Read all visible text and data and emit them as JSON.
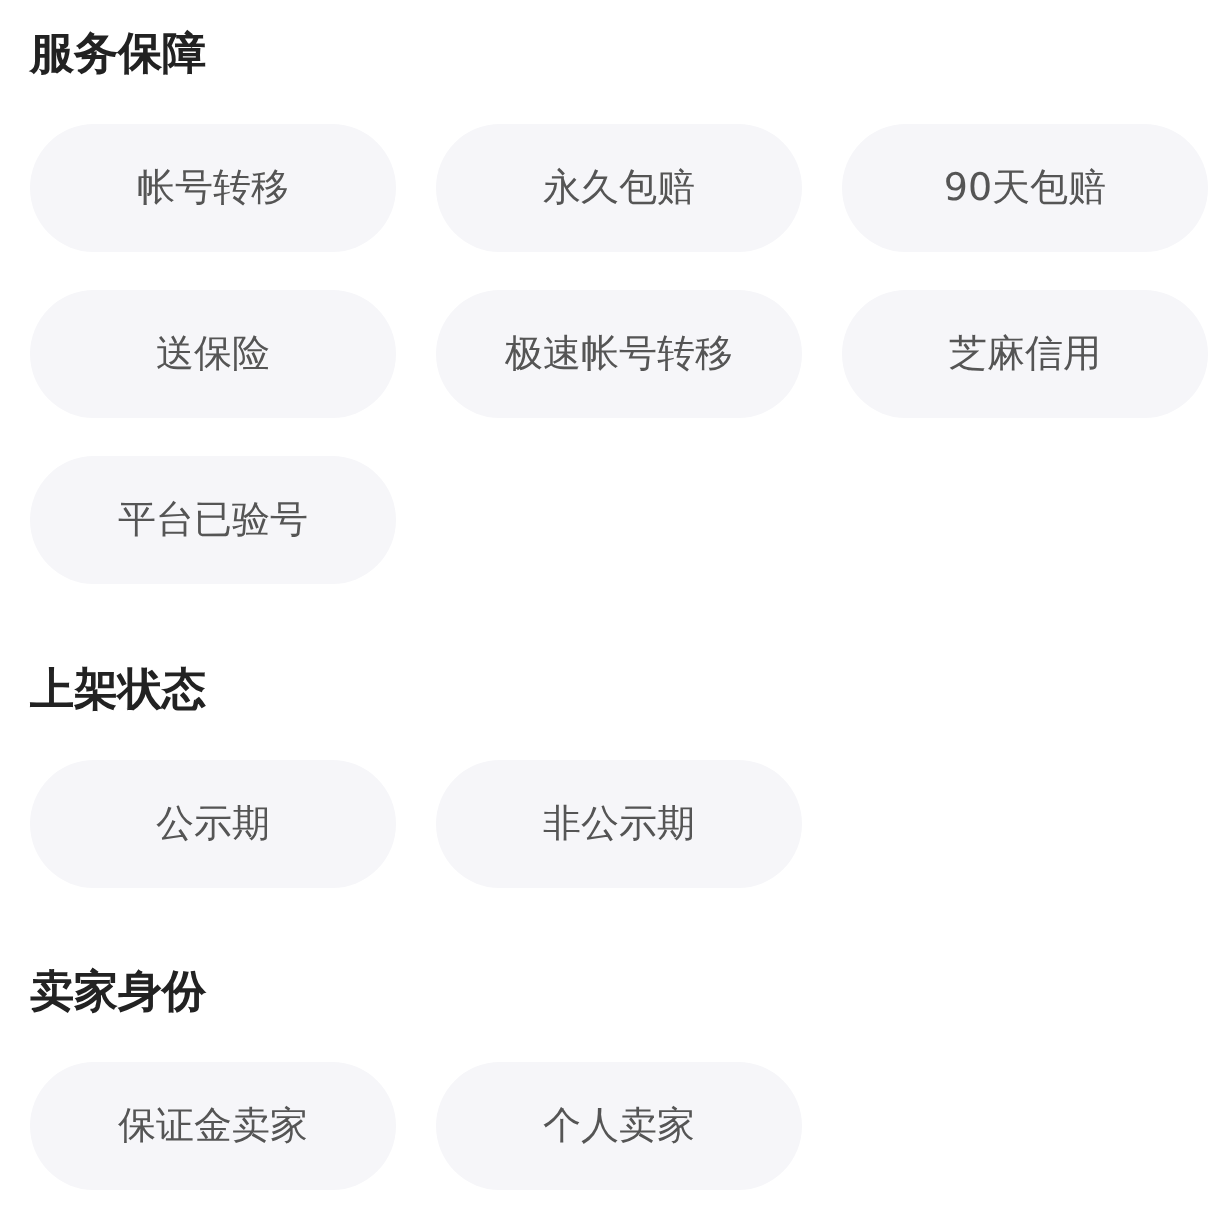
{
  "sections": [
    {
      "title": "服务保障",
      "options": [
        {
          "label": "帐号转移",
          "selected": false
        },
        {
          "label": "永久包赔",
          "selected": false
        },
        {
          "label": "90天包赔",
          "selected": false
        },
        {
          "label": "送保险",
          "selected": false
        },
        {
          "label": "极速帐号转移",
          "selected": false
        },
        {
          "label": "芝麻信用",
          "selected": false
        },
        {
          "label": "平台已验号",
          "selected": false
        }
      ]
    },
    {
      "title": "上架状态",
      "options": [
        {
          "label": "公示期",
          "selected": false
        },
        {
          "label": "非公示期",
          "selected": false
        }
      ]
    },
    {
      "title": "卖家身份",
      "options": [
        {
          "label": "保证金卖家",
          "selected": false
        },
        {
          "label": "个人卖家",
          "selected": false
        }
      ]
    }
  ]
}
